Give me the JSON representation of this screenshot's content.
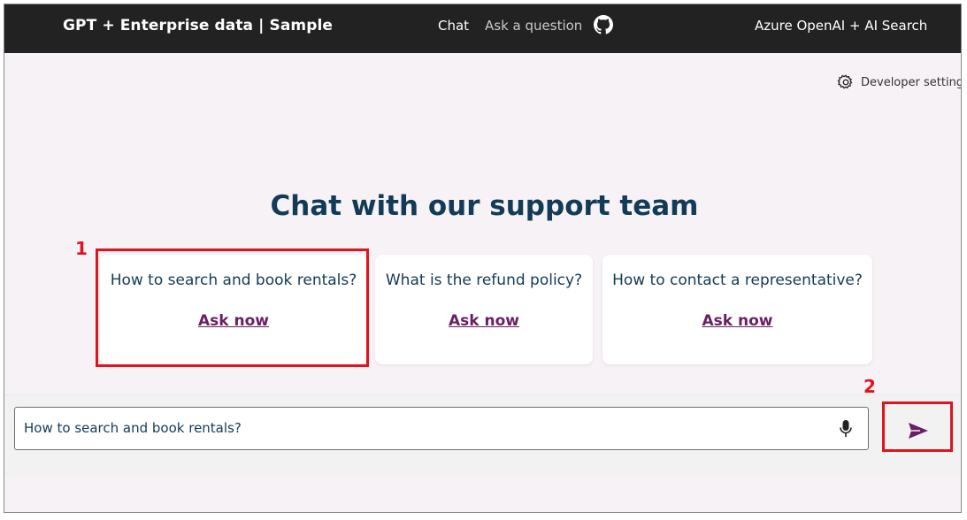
{
  "header": {
    "brand": "GPT + Enterprise data | Sample",
    "nav": {
      "chat": "Chat",
      "ask": "Ask a question"
    },
    "right_label": "Azure OpenAI + AI Search",
    "github_icon": "github-icon"
  },
  "developer_settings": {
    "label": "Developer settings",
    "icon": "gear-icon"
  },
  "headline": "Chat with our support team",
  "examples": [
    {
      "question": "How to search and book rentals?",
      "action": "Ask now"
    },
    {
      "question": "What is the refund policy?",
      "action": "Ask now"
    },
    {
      "question": "How to contact a representative?",
      "action": "Ask now"
    }
  ],
  "annotations": {
    "step1": "1",
    "step2": "2",
    "color": "#e0141e"
  },
  "composer": {
    "value": "How to search and book rentals?",
    "mic_icon": "microphone-icon",
    "send_icon": "send-icon"
  },
  "colors": {
    "topbar": "#222222",
    "accent": "#6a1f62",
    "heading": "#123b57",
    "background": "#f6f2f5"
  }
}
